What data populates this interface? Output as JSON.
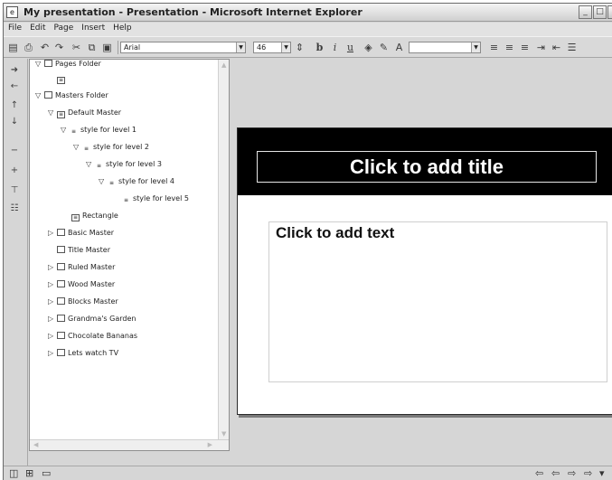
{
  "window": {
    "title": "My presentation - Presentation - Microsoft Internet Explorer"
  },
  "title_controls": {
    "minimize": "_",
    "maximize": "□",
    "close": "✕"
  },
  "menu": [
    "File",
    "Edit",
    "Page",
    "Insert",
    "Help"
  ],
  "toolbar": {
    "font_name": "Arial",
    "font_size": "46",
    "bold": "b",
    "italic": "i",
    "underline": "u"
  },
  "tree": {
    "items": [
      {
        "label": "Pages Folder",
        "expander": "▽",
        "icon": "folder"
      },
      {
        "label": "",
        "expander": "",
        "icon": "page"
      },
      {
        "label": "Masters Folder",
        "expander": "▽",
        "icon": "folder"
      },
      {
        "label": "Default Master",
        "expander": "▽",
        "icon": "master"
      },
      {
        "label": "style for level 1",
        "expander": "▽",
        "icon": "style"
      },
      {
        "label": "style for level 2",
        "expander": "▽",
        "icon": "style"
      },
      {
        "label": "style for level 3",
        "expander": "▽",
        "icon": "style"
      },
      {
        "label": "style for level 4",
        "expander": "▽",
        "icon": "style"
      },
      {
        "label": "style for level 5",
        "expander": "",
        "icon": "style"
      },
      {
        "label": "Rectangle",
        "expander": "",
        "icon": "rect"
      },
      {
        "label": "Basic Master",
        "expander": "▷",
        "icon": "master"
      },
      {
        "label": "Title Master",
        "expander": "",
        "icon": "master"
      },
      {
        "label": "Ruled Master",
        "expander": "▷",
        "icon": "master"
      },
      {
        "label": "Wood Master",
        "expander": "▷",
        "icon": "master"
      },
      {
        "label": "Blocks Master",
        "expander": "▷",
        "icon": "master"
      },
      {
        "label": "Grandma's Garden",
        "expander": "▷",
        "icon": "master"
      },
      {
        "label": "Chocolate Bananas",
        "expander": "▷",
        "icon": "master"
      },
      {
        "label": "Lets watch TV",
        "expander": "▷",
        "icon": "master"
      }
    ]
  },
  "slide": {
    "title_placeholder": "Click to add title",
    "text_placeholder": "Click to add text"
  },
  "icons": {
    "toolbar": [
      "save-icon",
      "print-icon",
      "undo-icon",
      "redo-icon",
      "cut-icon",
      "copy-icon",
      "paste-icon",
      "fill-color-icon",
      "line-color-icon",
      "text-color-icon",
      "align-left-icon",
      "align-center-icon",
      "align-right-icon",
      "indent-icon",
      "outdent-icon",
      "justify-icon"
    ],
    "sidebar": [
      "move-right-icon",
      "move-left-icon",
      "move-up-icon",
      "move-down-icon",
      "delete-icon",
      "add-icon",
      "level-icon",
      "outline-icon"
    ],
    "status_left": [
      "slide-view-icon",
      "sorter-view-icon",
      "notes-view-icon"
    ],
    "status_right": [
      "first-page-icon",
      "previous-page-icon",
      "next-page-icon",
      "last-page-icon",
      "menu-icon"
    ]
  },
  "colors": {
    "slide_band": "#000000",
    "title_text": "#ffffff",
    "window_bg": "#d6d6d6"
  }
}
